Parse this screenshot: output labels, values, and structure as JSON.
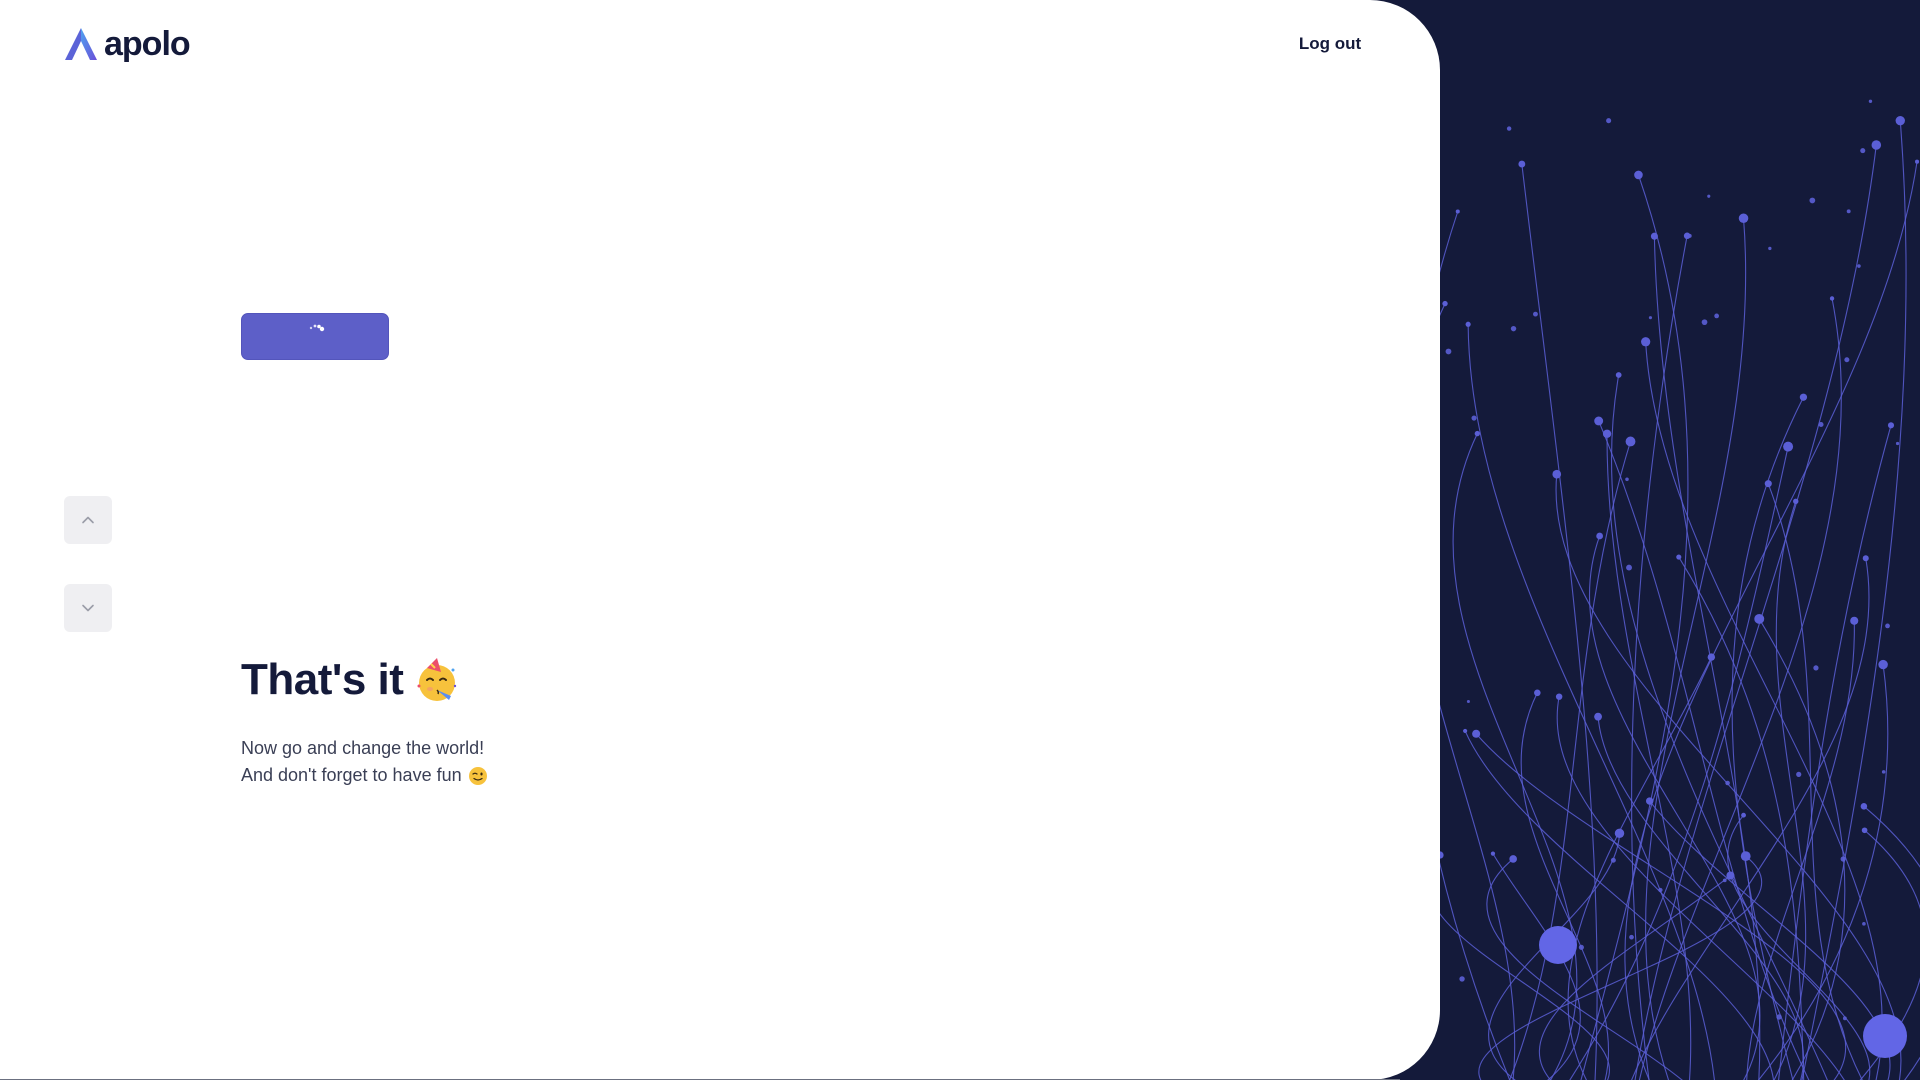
{
  "brand": {
    "name": "apolo",
    "logo_icon": "apolo-logo-icon"
  },
  "header": {
    "logout_label": "Log out"
  },
  "primary_action": {
    "state": "loading",
    "spinner_icon": "loading-spinner-icon"
  },
  "navigation": {
    "up_icon": "chevron-up-icon",
    "down_icon": "chevron-down-icon"
  },
  "content": {
    "title": "That's it",
    "title_emoji_icon": "partying-face-emoji-icon",
    "line1": "Now go and change the world!",
    "line2": "And don't forget to have fun",
    "line2_emoji_icon": "winking-face-emoji-icon"
  },
  "colors": {
    "accent": "#5d5fc8",
    "dark": "#141a3a",
    "muted_button": "#efeff2",
    "art_line": "#5b5fd6"
  }
}
